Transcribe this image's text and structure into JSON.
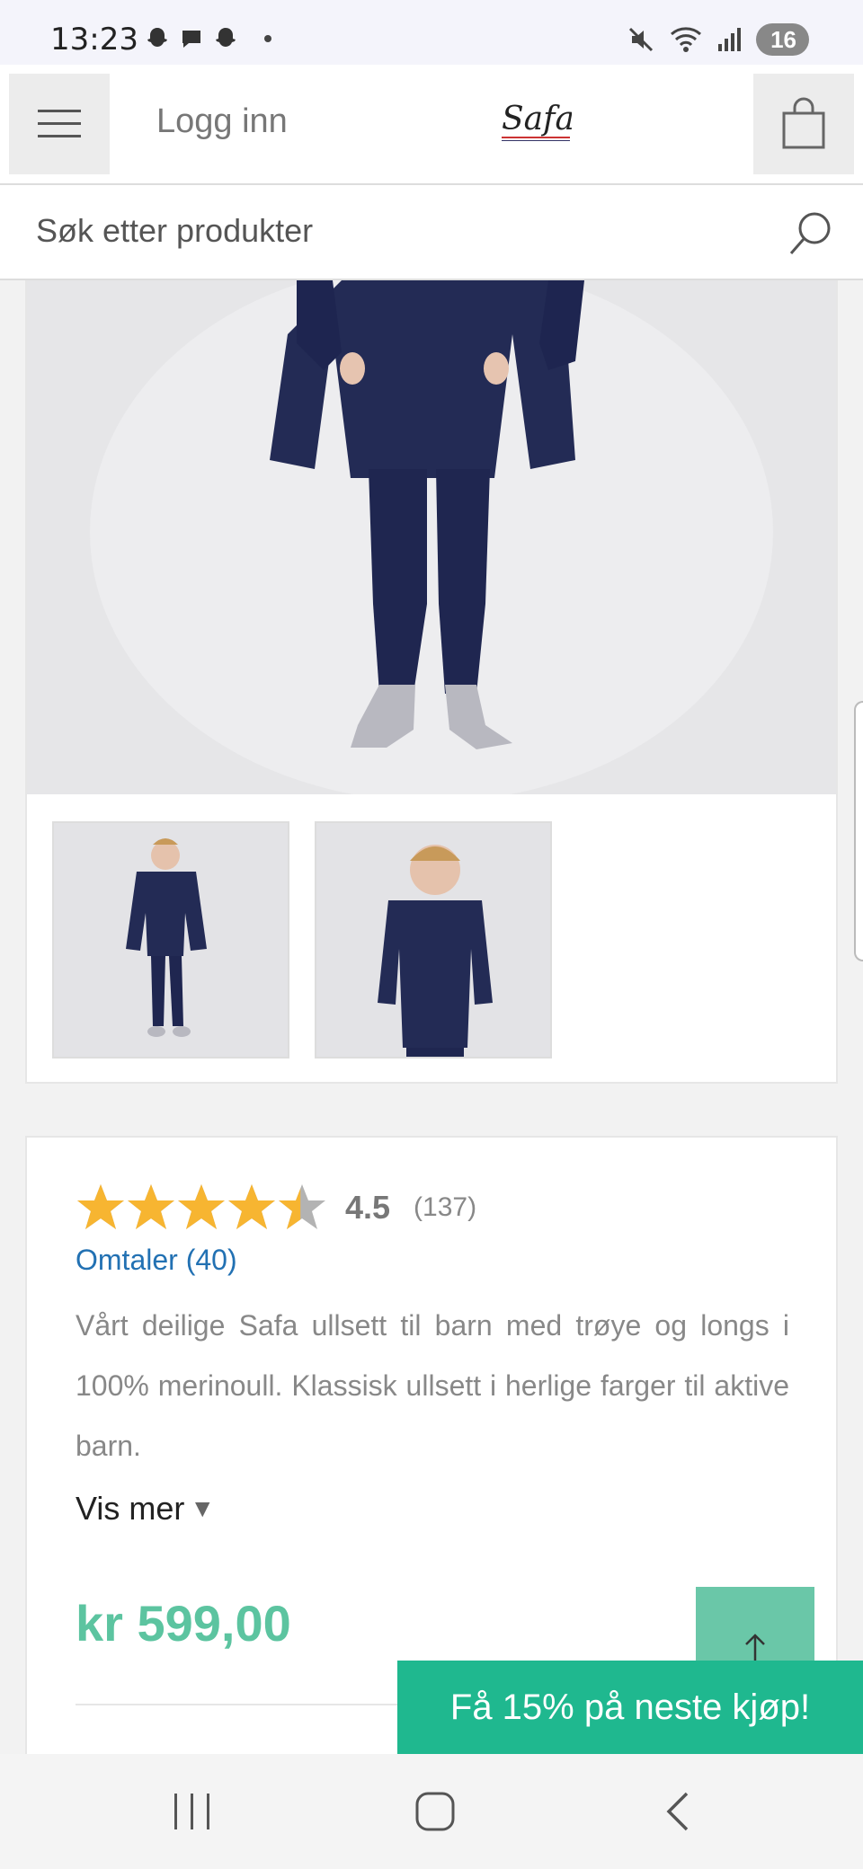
{
  "status_bar": {
    "time": "13:23",
    "battery": "16"
  },
  "header": {
    "login_label": "Logg inn",
    "logo_text": "Safa"
  },
  "search": {
    "placeholder": "Søk etter produkter"
  },
  "product": {
    "rating_value": "4.5",
    "rating_count": "(137)",
    "rating_fraction": 0.9,
    "reviews_link": "Omtaler (40)",
    "description": "Vårt deilige Safa ullsett til barn med trøye og longs i 100% merinoull. Klassisk ullsett i herlige farger til aktive barn.",
    "show_more_label": "Vis mer",
    "show_more_arrow": "▼",
    "price": "kr 599,00"
  },
  "promo": {
    "label": "Få 15% på neste kjøp!"
  },
  "colors": {
    "accent_green": "#5cc4a0",
    "promo_green": "#1fb88f",
    "link_blue": "#2271b3",
    "star_gold": "#f7b531"
  }
}
